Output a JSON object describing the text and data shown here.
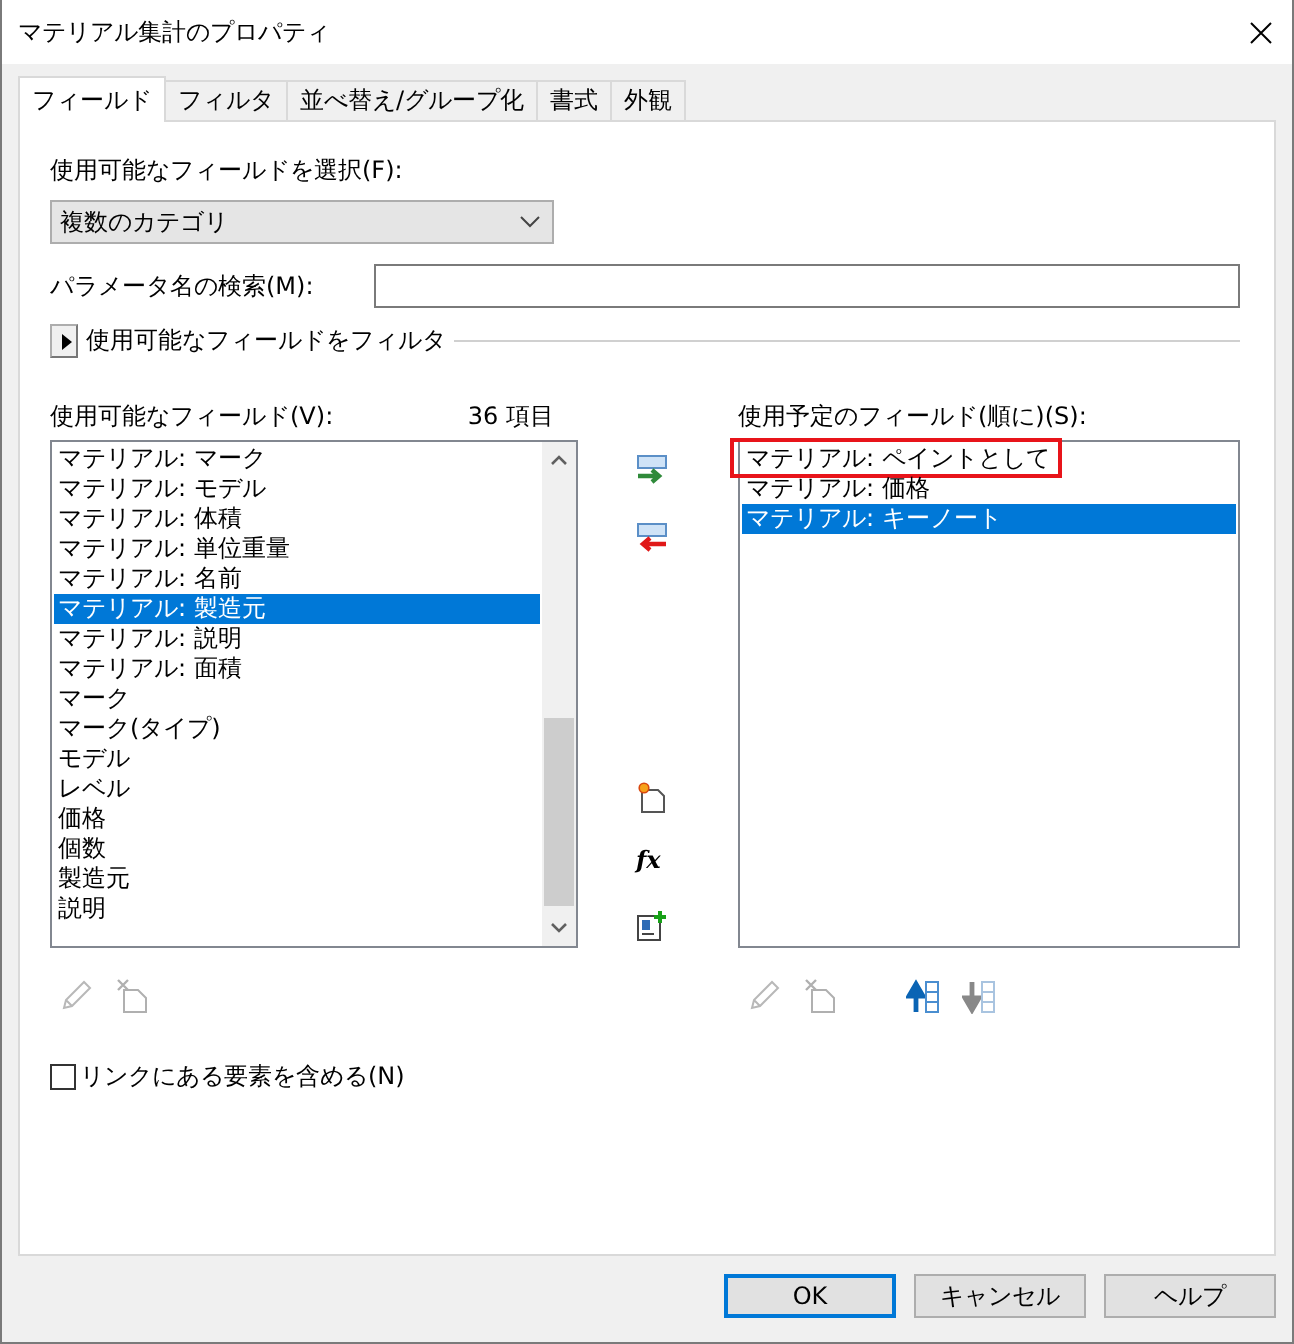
{
  "window": {
    "title": "マテリアル集計のプロパティ"
  },
  "tabs": [
    {
      "label": "フィールド",
      "selected": true
    },
    {
      "label": "フィルタ",
      "selected": false
    },
    {
      "label": "並べ替え/グループ化",
      "selected": false
    },
    {
      "label": "書式",
      "selected": false
    },
    {
      "label": "外観",
      "selected": false
    }
  ],
  "field_category": {
    "label": "使用可能なフィールドを選択(F):",
    "value": "複数のカテゴリ"
  },
  "parameter_search": {
    "label": "パラメータ名の検索(M):"
  },
  "field_filter": {
    "label": "使用可能なフィールドをフィルタ",
    "expanded": false
  },
  "available_fields": {
    "label": "使用可能なフィールド(V):",
    "count": "36 項目",
    "items": [
      {
        "text": "マテリアル: マーク",
        "selected": false
      },
      {
        "text": "マテリアル: モデル",
        "selected": false
      },
      {
        "text": "マテリアル: 体積",
        "selected": false
      },
      {
        "text": "マテリアル: 単位重量",
        "selected": false
      },
      {
        "text": "マテリアル: 名前",
        "selected": false
      },
      {
        "text": "マテリアル: 製造元",
        "selected": true
      },
      {
        "text": "マテリアル: 説明",
        "selected": false
      },
      {
        "text": "マテリアル: 面積",
        "selected": false
      },
      {
        "text": "マーク",
        "selected": false
      },
      {
        "text": "マーク(タイプ)",
        "selected": false
      },
      {
        "text": "モデル",
        "selected": false
      },
      {
        "text": "レベル",
        "selected": false
      },
      {
        "text": "価格",
        "selected": false
      },
      {
        "text": "個数",
        "selected": false
      },
      {
        "text": "製造元",
        "selected": false
      },
      {
        "text": "説明",
        "selected": false
      }
    ]
  },
  "formula_tool": {
    "label": "fx"
  },
  "scheduled_fields": {
    "label": "使用予定のフィールド(順に)(S):",
    "items": [
      {
        "text": "マテリアル: ペイントとして",
        "selected": false,
        "highlighted": true
      },
      {
        "text": "マテリアル: 価格",
        "selected": false,
        "highlighted": false
      },
      {
        "text": "マテリアル: キーノート",
        "selected": true,
        "highlighted": false
      }
    ]
  },
  "include_links": {
    "label": "リンクにある要素を含める(N)",
    "checked": false
  },
  "buttons": [
    {
      "label": "OK",
      "default": true
    },
    {
      "label": "キャンセル",
      "default": false
    },
    {
      "label": "ヘルプ",
      "default": false
    }
  ]
}
